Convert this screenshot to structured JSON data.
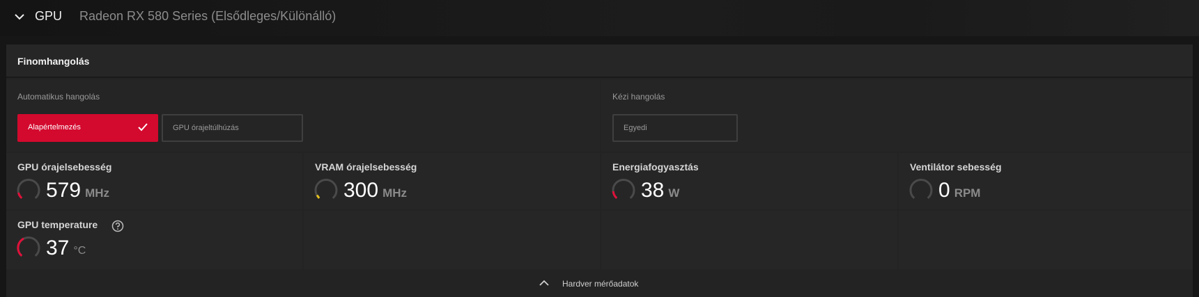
{
  "header": {
    "section": "GPU",
    "device": "Radeon RX 580 Series (Elsődleges/Különálló)"
  },
  "panel": {
    "title": "Finomhangolás",
    "auto_tuning": {
      "label": "Automatikus hangolás",
      "default_button": "Alapértelmezés",
      "overclock_button": "GPU órajeltúlhúzás"
    },
    "manual_tuning": {
      "label": "Kézi hangolás",
      "custom_button": "Egyedi"
    }
  },
  "metrics": [
    {
      "title": "GPU órajelsebesség",
      "value": "579",
      "unit": "MHz",
      "gauge_color": "#e0103a"
    },
    {
      "title": "VRAM órajelsebesség",
      "value": "300",
      "unit": "MHz",
      "gauge_color": "#e8c21c"
    },
    {
      "title": "Energiafogyasztás",
      "value": "38",
      "unit": "W",
      "gauge_color": "#e0103a"
    },
    {
      "title": "Ventilátor sebesség",
      "value": "0",
      "unit": "RPM",
      "gauge_color": "#4a4a4a"
    },
    {
      "title": "GPU temperature",
      "value": "37",
      "unit": "°C",
      "gauge_color": "#e0103a"
    }
  ],
  "footer": {
    "label": "Hardver mérőadatok"
  },
  "colors": {
    "accent": "#d3092e",
    "background": "#161616",
    "panel": "#232323"
  }
}
